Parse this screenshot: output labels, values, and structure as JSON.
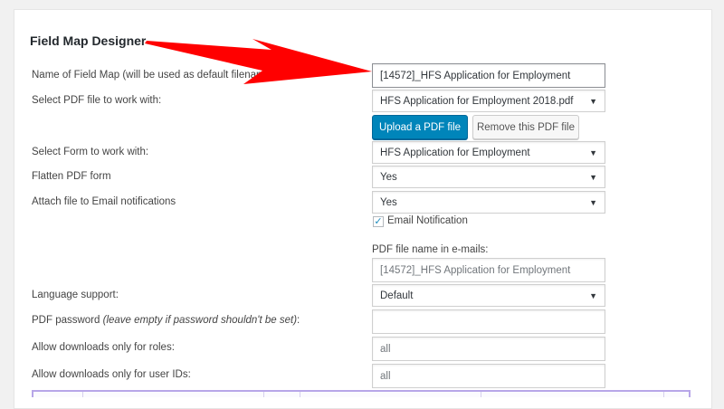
{
  "heading": "Field Map Designer",
  "rows": {
    "name": {
      "label": "Name of Field Map (will be used as default filename):",
      "value": "[14572]_HFS Application for Employment"
    },
    "pdf_file": {
      "label": "Select PDF file to work with:",
      "value": "HFS Application for Employment 2018.pdf",
      "upload_button": "Upload a PDF file",
      "remove_button": "Remove this PDF file"
    },
    "form": {
      "label": "Select Form to work with:",
      "value": "HFS Application for Employment"
    },
    "flatten": {
      "label": "Flatten PDF form",
      "value": "Yes"
    },
    "attach": {
      "label": "Attach file to Email notifications",
      "value": "Yes",
      "checkbox_label": "Email Notification",
      "checkbox_checked": true,
      "filename_label": "PDF file name in e-mails:",
      "filename_placeholder": "[14572]_HFS Application for Employment"
    },
    "language": {
      "label": "Language support:",
      "value": "Default"
    },
    "password": {
      "label": "PDF password",
      "hint": "(leave empty if password shouldn't be set)",
      "suffix": ":",
      "value": ""
    },
    "roles": {
      "label": "Allow downloads only for roles:",
      "placeholder": "all"
    },
    "user_ids": {
      "label": "Allow downloads only for user IDs:",
      "placeholder": "all"
    }
  },
  "icons": {
    "caret": "▼",
    "check": "✓"
  },
  "colors": {
    "primary_button": "#0085ba",
    "annotation_arrow": "#ff0000",
    "table_border": "#b7a6e8"
  }
}
